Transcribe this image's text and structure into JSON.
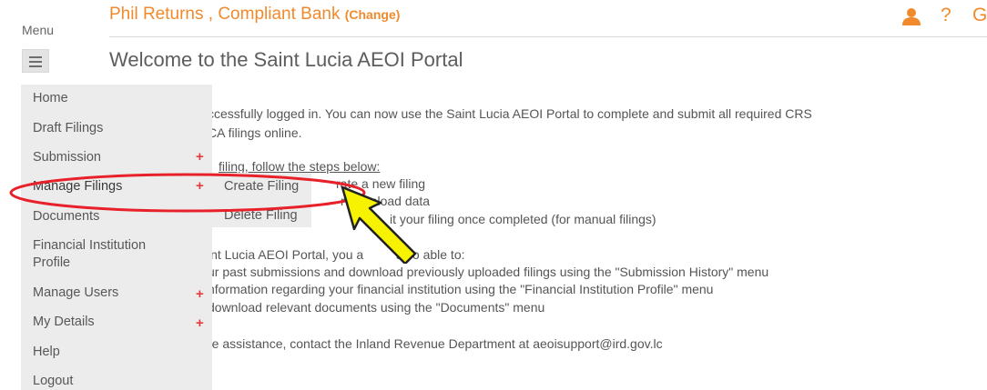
{
  "header": {
    "title": "Phil Returns , Compliant Bank",
    "change_label": "(Change)",
    "help_icon": "?",
    "logout_icon": "G",
    "accent_color": "#f08a2c"
  },
  "menu": {
    "label": "Menu",
    "items": [
      {
        "label": "Home",
        "has_plus": false
      },
      {
        "label": "Draft Filings",
        "has_plus": false
      },
      {
        "label": "Submission",
        "has_plus": true
      },
      {
        "label": "Manage Filings",
        "has_plus": true
      },
      {
        "label": "Documents",
        "has_plus": false
      },
      {
        "label": "Financial Institution",
        "label2": "Profile",
        "has_plus": false
      },
      {
        "label": "Manage Users",
        "has_plus": true
      },
      {
        "label": "My Details",
        "has_plus": true
      },
      {
        "label": "Help",
        "has_plus": false
      },
      {
        "label": "Logout",
        "has_plus": false
      }
    ],
    "plus_symbol": "+",
    "submenu": [
      "Create Filing",
      "Delete Filing"
    ]
  },
  "main": {
    "title": "Welcome to the Saint Lucia AEOI Portal",
    "intro_line1": "ccessfully logged in. You can now use the Saint Lucia AEOI Portal to complete and submit all required CRS",
    "intro_line2": "CA filings online.",
    "steps_heading": "filing, follow the steps below:",
    "step1": "rate a new filing",
    "step2": "r or upload data",
    "step3": "it your filing once completed (for manual filings)",
    "also_a": "int Lucia AEOI Portal, you a",
    "also_b": "also able to:",
    "also1": "ur past submissions and download previously uploaded filings using the \"Submission History\" menu",
    "also2": "nformation regarding your financial institution using the \"Financial Institution Profile\" menu",
    "also3": "download relevant documents using the \"Documents\" menu",
    "contact": "re assistance, contact the Inland Revenue Department at aeoisupport@ird.gov.lc"
  },
  "annotations": {
    "ellipse_color": "#e8202a",
    "arrow_fill": "#f7f200",
    "arrow_stroke": "#222222"
  }
}
